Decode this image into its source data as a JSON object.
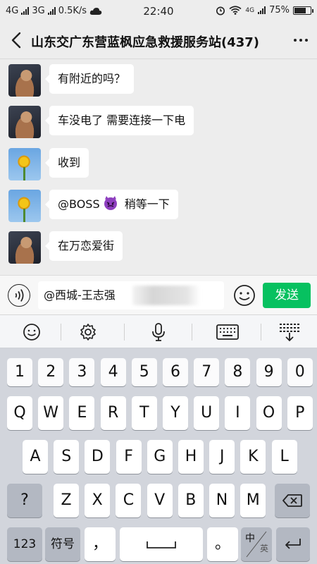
{
  "status_bar": {
    "net1": "4G",
    "net2": "3G",
    "speed": "0.5K/s",
    "time": "22:40",
    "net3": "4G",
    "battery": "75%",
    "battery_level": 0.75
  },
  "header": {
    "title": "山东交广东营蓝枫应急救援服务站(437)"
  },
  "messages": [
    {
      "avatar": "man-avatar",
      "text": "有附近的吗？"
    },
    {
      "avatar": "man-avatar",
      "text": "车没电了  需要连接一下电"
    },
    {
      "avatar": "flower-avatar",
      "text": "收到"
    },
    {
      "avatar": "flower-avatar",
      "mention": "@BOSS",
      "emoji": "devil-emoji",
      "text": " 稍等一下"
    },
    {
      "avatar": "man-avatar",
      "text": "在万恋爱街"
    }
  ],
  "input": {
    "value": "@西城-王志强",
    "send_label": "发送"
  },
  "keyboard": {
    "toolbar_icons": [
      "smiley-icon",
      "gear-icon",
      "microphone-icon",
      "keyboard-icon",
      "collapse-keyboard-icon"
    ],
    "number_row": [
      "1",
      "2",
      "3",
      "4",
      "5",
      "6",
      "7",
      "8",
      "9",
      "0"
    ],
    "row1": [
      "Q",
      "W",
      "E",
      "R",
      "T",
      "Y",
      "U",
      "I",
      "O",
      "P"
    ],
    "row2": [
      "A",
      "S",
      "D",
      "F",
      "G",
      "H",
      "J",
      "K",
      "L"
    ],
    "row3_left": "?",
    "row3": [
      "Z",
      "X",
      "C",
      "V",
      "B",
      "N",
      "M"
    ],
    "key_123": "123",
    "key_symbols": "符号",
    "key_comma": "，",
    "key_period": "。",
    "key_lang_zh": "中",
    "key_lang_en": "英"
  },
  "colors": {
    "send_green": "#07c160",
    "chat_background": "#ededed",
    "keyboard_background": "#d2d5dc"
  }
}
